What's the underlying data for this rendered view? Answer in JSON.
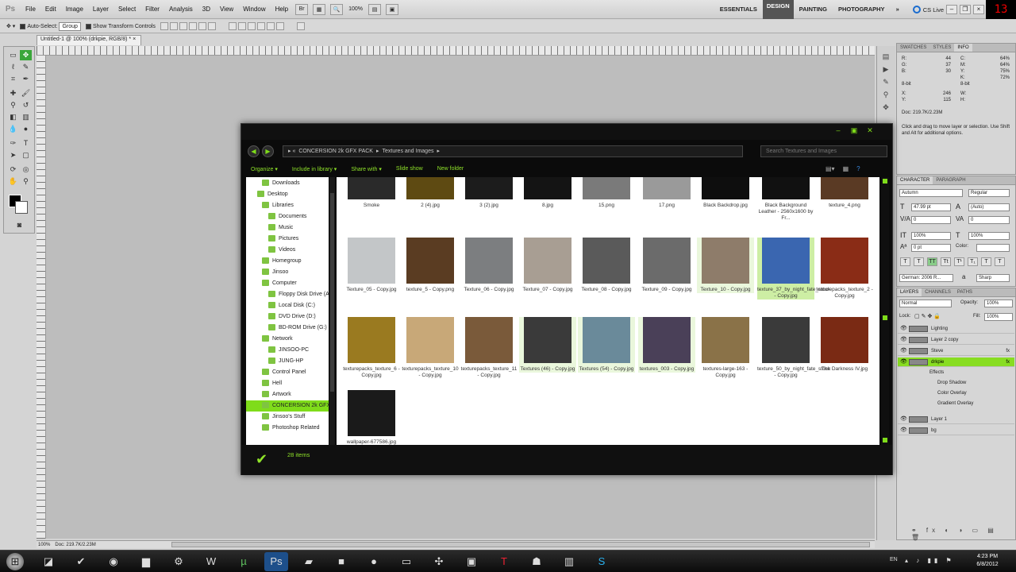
{
  "app": {
    "logo": "Ps",
    "menu": [
      "File",
      "Edit",
      "Image",
      "Layer",
      "Select",
      "Filter",
      "Analysis",
      "3D",
      "View",
      "Window",
      "Help"
    ],
    "zoom": "100%"
  },
  "workspaces": {
    "items": [
      "ESSENTIALS",
      "DESIGN",
      "PAINTING",
      "PHOTOGRAPHY"
    ],
    "active": "DESIGN",
    "more": "»",
    "cs_live": "CS Live"
  },
  "clock_display": "13",
  "options": {
    "auto_select_label": "Auto-Select:",
    "auto_select_value": "Group",
    "show_transform": "Show Transform Controls"
  },
  "document": {
    "tab": "Untitled-1 @ 100% (drkpie, RGB/8) *",
    "zoom": "100%",
    "doc_size": "Doc: 219.7K/2.23M"
  },
  "info_panel": {
    "tabs": [
      "SWATCHES",
      "STYLES",
      "INFO"
    ],
    "active_tab": "INFO",
    "rgb": [
      [
        "R:",
        "44"
      ],
      [
        "G:",
        "37"
      ],
      [
        "B:",
        "30"
      ]
    ],
    "cmyk": [
      [
        "C:",
        "64%"
      ],
      [
        "M:",
        "64%"
      ],
      [
        "Y:",
        "75%"
      ],
      [
        "K:",
        "72%"
      ]
    ],
    "bits": [
      "8-bit",
      "8-bit"
    ],
    "xy": [
      [
        "X:",
        "246"
      ],
      [
        "Y:",
        "115"
      ]
    ],
    "wh": [
      [
        "W:",
        ""
      ],
      [
        "H:",
        ""
      ]
    ],
    "doc": "Doc: 219.7K/2.23M",
    "hint": "Click and drag to move layer or selection. Use Shift and Alt for additional options."
  },
  "character_panel": {
    "tabs": [
      "CHARACTER",
      "PARAGRAPH"
    ],
    "font_family": "Autumn",
    "font_style": "Regular",
    "size": "47.99 pt",
    "leading": "(Auto)",
    "kerning": "0",
    "tracking": "0",
    "vscale": "100%",
    "hscale": "100%",
    "baseline": "0 pt",
    "color_label": "Color:",
    "language": "German: 2006 R...",
    "aa": "Sharp",
    "aa_label": "a",
    "style_buttons": [
      "T",
      "T",
      "TT",
      "Tt",
      "T¹",
      "T₁",
      "T",
      "T"
    ]
  },
  "layers_panel": {
    "tabs": [
      "LAYERS",
      "CHANNELS",
      "PATHS"
    ],
    "blend_mode": "Normal",
    "opacity_label": "Opacity:",
    "opacity": "100%",
    "lock_label": "Lock:",
    "fill_label": "Fill:",
    "fill": "100%",
    "layers": [
      {
        "name": "Lighting",
        "fx": false,
        "selected": false
      },
      {
        "name": "Layer 2 copy",
        "fx": false,
        "selected": false
      },
      {
        "name": "Steve",
        "fx": true,
        "selected": false
      },
      {
        "name": "drkpie",
        "fx": true,
        "selected": true
      }
    ],
    "effects_label": "Effects",
    "effects": [
      "Drop Shadow",
      "Color Overlay",
      "Gradient Overlay"
    ],
    "layers_bottom": [
      {
        "name": "Layer 1",
        "selected": false
      },
      {
        "name": "bg",
        "selected": false
      }
    ]
  },
  "explorer": {
    "address": [
      "CONCERSION 2k GFX PACK",
      "Textures and Images"
    ],
    "search_placeholder": "Search Textures and Images",
    "commands": [
      "Organize ▾",
      "Include in library ▾",
      "Share with ▾",
      "Slide show",
      "New folder"
    ],
    "nav": [
      {
        "label": "Downloads",
        "indent": 20,
        "active": false
      },
      {
        "label": "Desktop",
        "indent": 14,
        "active": false
      },
      {
        "label": "Libraries",
        "indent": 20,
        "active": false
      },
      {
        "label": "Documents",
        "indent": 28,
        "active": false
      },
      {
        "label": "Music",
        "indent": 28,
        "active": false
      },
      {
        "label": "Pictures",
        "indent": 28,
        "active": false
      },
      {
        "label": "Videos",
        "indent": 28,
        "active": false
      },
      {
        "label": "Homegroup",
        "indent": 20,
        "active": false
      },
      {
        "label": "Jinsoo",
        "indent": 20,
        "active": false
      },
      {
        "label": "Computer",
        "indent": 20,
        "active": false
      },
      {
        "label": "Floppy Disk Drive (A:)",
        "indent": 28,
        "active": false
      },
      {
        "label": "Local Disk (C:)",
        "indent": 28,
        "active": false
      },
      {
        "label": "DVD Drive (D:)",
        "indent": 28,
        "active": false
      },
      {
        "label": "BD-ROM Drive (G:)",
        "indent": 28,
        "active": false
      },
      {
        "label": "Network",
        "indent": 20,
        "active": false
      },
      {
        "label": "JINSOO-PC",
        "indent": 28,
        "active": false
      },
      {
        "label": "JUNG-HP",
        "indent": 28,
        "active": false
      },
      {
        "label": "Control Panel",
        "indent": 20,
        "active": false
      },
      {
        "label": "Hell",
        "indent": 20,
        "active": false
      },
      {
        "label": "Artwork",
        "indent": 20,
        "active": false
      },
      {
        "label": "CONCERSION 2k GFX PACK",
        "indent": 20,
        "active": true
      },
      {
        "label": "Jinsoo's Stuff",
        "indent": 20,
        "active": false
      },
      {
        "label": "Photoshop Related",
        "indent": 20,
        "active": false
      }
    ],
    "files": [
      {
        "name": "Smoke",
        "color": "#2a2a2a",
        "hl": false
      },
      {
        "name": "2 (4).jpg",
        "color": "#5e4a12",
        "hl": false
      },
      {
        "name": "3 (2).jpg",
        "color": "#1c1c1c",
        "hl": false
      },
      {
        "name": "8.jpg",
        "color": "#141414",
        "hl": false
      },
      {
        "name": "15.png",
        "color": "#7a7a7a",
        "hl": false
      },
      {
        "name": "17.png",
        "color": "#9a9a9a",
        "hl": false
      },
      {
        "name": "Black Backdrop.jpg",
        "color": "#0e0e0e",
        "hl": false
      },
      {
        "name": "Black Background Leather - 2560x1600 by Fr...",
        "color": "#111111",
        "hl": false
      },
      {
        "name": "texture_4.png",
        "color": "#5a3a24",
        "hl": false
      },
      {
        "name": "Texture_05 - Copy.jpg",
        "color": "#c3c6c8",
        "hl": false
      },
      {
        "name": "texture_5 - Copy.png",
        "color": "#5a3c22",
        "hl": false
      },
      {
        "name": "Texture_06 - Copy.jpg",
        "color": "#7c7e80",
        "hl": false
      },
      {
        "name": "Texture_07 - Copy.jpg",
        "color": "#a89e93",
        "hl": false
      },
      {
        "name": "Texture_08 - Copy.jpg",
        "color": "#5a5a5a",
        "hl": false
      },
      {
        "name": "Texture_09 - Copy.jpg",
        "color": "#6b6b6b",
        "hl": false
      },
      {
        "name": "Texture_10 - Copy.jpg",
        "color": "#8e7c6a",
        "hl": true
      },
      {
        "name": "texture_37_by_night_fate_stock - Copy.jpg",
        "color": "#3a66b0",
        "hl": "selected"
      },
      {
        "name": "texturepacks_texture_2 - Copy.jpg",
        "color": "#8a2c16",
        "hl": false
      },
      {
        "name": "texturepacks_texture_6 - Copy.jpg",
        "color": "#9a7a20",
        "hl": false
      },
      {
        "name": "texturepacks_texture_10 - Copy.jpg",
        "color": "#c8a878",
        "hl": false
      },
      {
        "name": "texturepacks_texture_11 - Copy.jpg",
        "color": "#7a5a3a",
        "hl": false
      },
      {
        "name": "Textures (46) - Copy.jpg",
        "color": "#3a3a3a",
        "hl": true
      },
      {
        "name": "Textures (54) - Copy.jpg",
        "color": "#6a8a9a",
        "hl": true
      },
      {
        "name": "textures_003 - Copy.jpg",
        "color": "#4a4058",
        "hl": true
      },
      {
        "name": "textures-large-163 - Copy.jpg",
        "color": "#8a7248",
        "hl": false
      },
      {
        "name": "texture_50_by_night_fate_stock - Copy.jpg",
        "color": "#3a3a3a",
        "hl": false
      },
      {
        "name": "The Darkness IV.jpg",
        "color": "#7a2a14",
        "hl": false
      },
      {
        "name": "wallpaper-677586.jpg",
        "color": "#1a1a1a",
        "hl": false
      }
    ],
    "item_count": "28 items"
  },
  "taskbar": {
    "apps": [
      "start",
      "explorer",
      "check",
      "steam",
      "folder",
      "gear",
      "word",
      "utorrent",
      "photoshop",
      "car",
      "minecraft",
      "globe",
      "terminal",
      "map",
      "files",
      "T",
      "dark",
      "monitor",
      "skype"
    ],
    "lang": "EN",
    "time": "4:23 PM",
    "date": "6/8/2012"
  }
}
